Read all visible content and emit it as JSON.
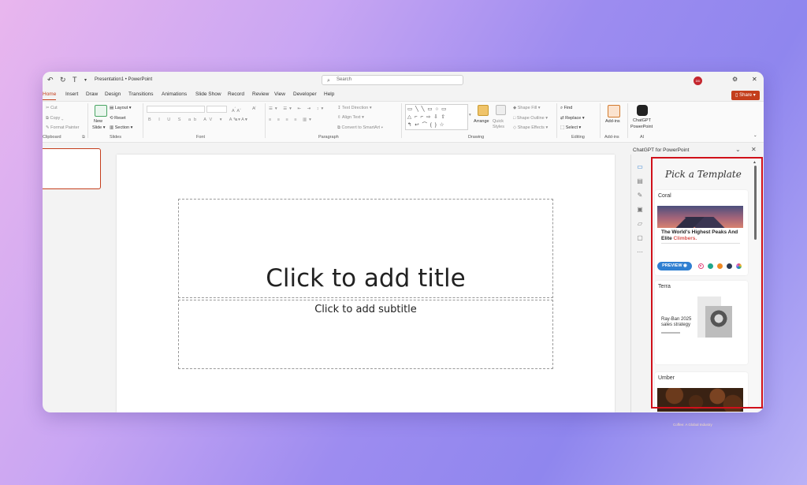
{
  "titlebar": {
    "doc_title": "Presentation1 • PowerPoint",
    "search_placeholder": "Search",
    "avatar_initials": "DD"
  },
  "tabs": [
    "Home",
    "Insert",
    "Draw",
    "Design",
    "Transitions",
    "Animations",
    "Slide Show",
    "Record",
    "Review",
    "View",
    "Developer",
    "Help"
  ],
  "active_tab": "Home",
  "share_label": "Share",
  "ribbon": {
    "clipboard": {
      "cut": "Cut",
      "copy": "Copy",
      "format_painter": "Format Painter",
      "label": "Clipboard"
    },
    "slides": {
      "new_slide": "New",
      "new_slide_2": "Slide",
      "layout": "Layout",
      "reset": "Reset",
      "section": "Section",
      "label": "Slides"
    },
    "font": {
      "label": "Font"
    },
    "paragraph": {
      "text_direction": "Text Direction",
      "align_text": "Align Text",
      "convert_smartart": "Convert to SmartArt",
      "label": "Paragraph"
    },
    "drawing": {
      "arrange": "Arrange",
      "quick_styles": "Quick Styles",
      "shape_fill": "Shape Fill",
      "shape_outline": "Shape Outline",
      "shape_effects": "Shape Effects",
      "label": "Drawing"
    },
    "editing": {
      "find": "Find",
      "replace": "Replace",
      "select": "Select",
      "label": "Editing"
    },
    "addins": {
      "addins": "Add-ins",
      "label": "Add-ins"
    },
    "ai": {
      "chatgpt_1": "ChatGPT",
      "chatgpt_2": "PowerPoint",
      "label": "AI"
    }
  },
  "slide": {
    "title_placeholder": "Click to add title",
    "subtitle_placeholder": "Click to add subtitle"
  },
  "pane": {
    "title": "ChatGPT for PowerPoint",
    "heading": "Pick a Template",
    "templates": [
      {
        "name": "Coral",
        "headline": "The World's Highest Peaks And Elite",
        "headline_accent": "Climbers.",
        "button": "PREVIEW",
        "swatch_colors": [
          "#e0457b",
          "#1fa68b",
          "#f08a24",
          "#2b3a55",
          "#c27ae8"
        ]
      },
      {
        "name": "Terra",
        "headline": "Ray-Ban 2025 sales strategy"
      },
      {
        "name": "Umber",
        "caption": "Coffee: A Global Industry"
      }
    ]
  },
  "colors": {
    "accent": "#c43e1c",
    "highlight": "#d0101a",
    "preview": "#2f7fd1"
  }
}
